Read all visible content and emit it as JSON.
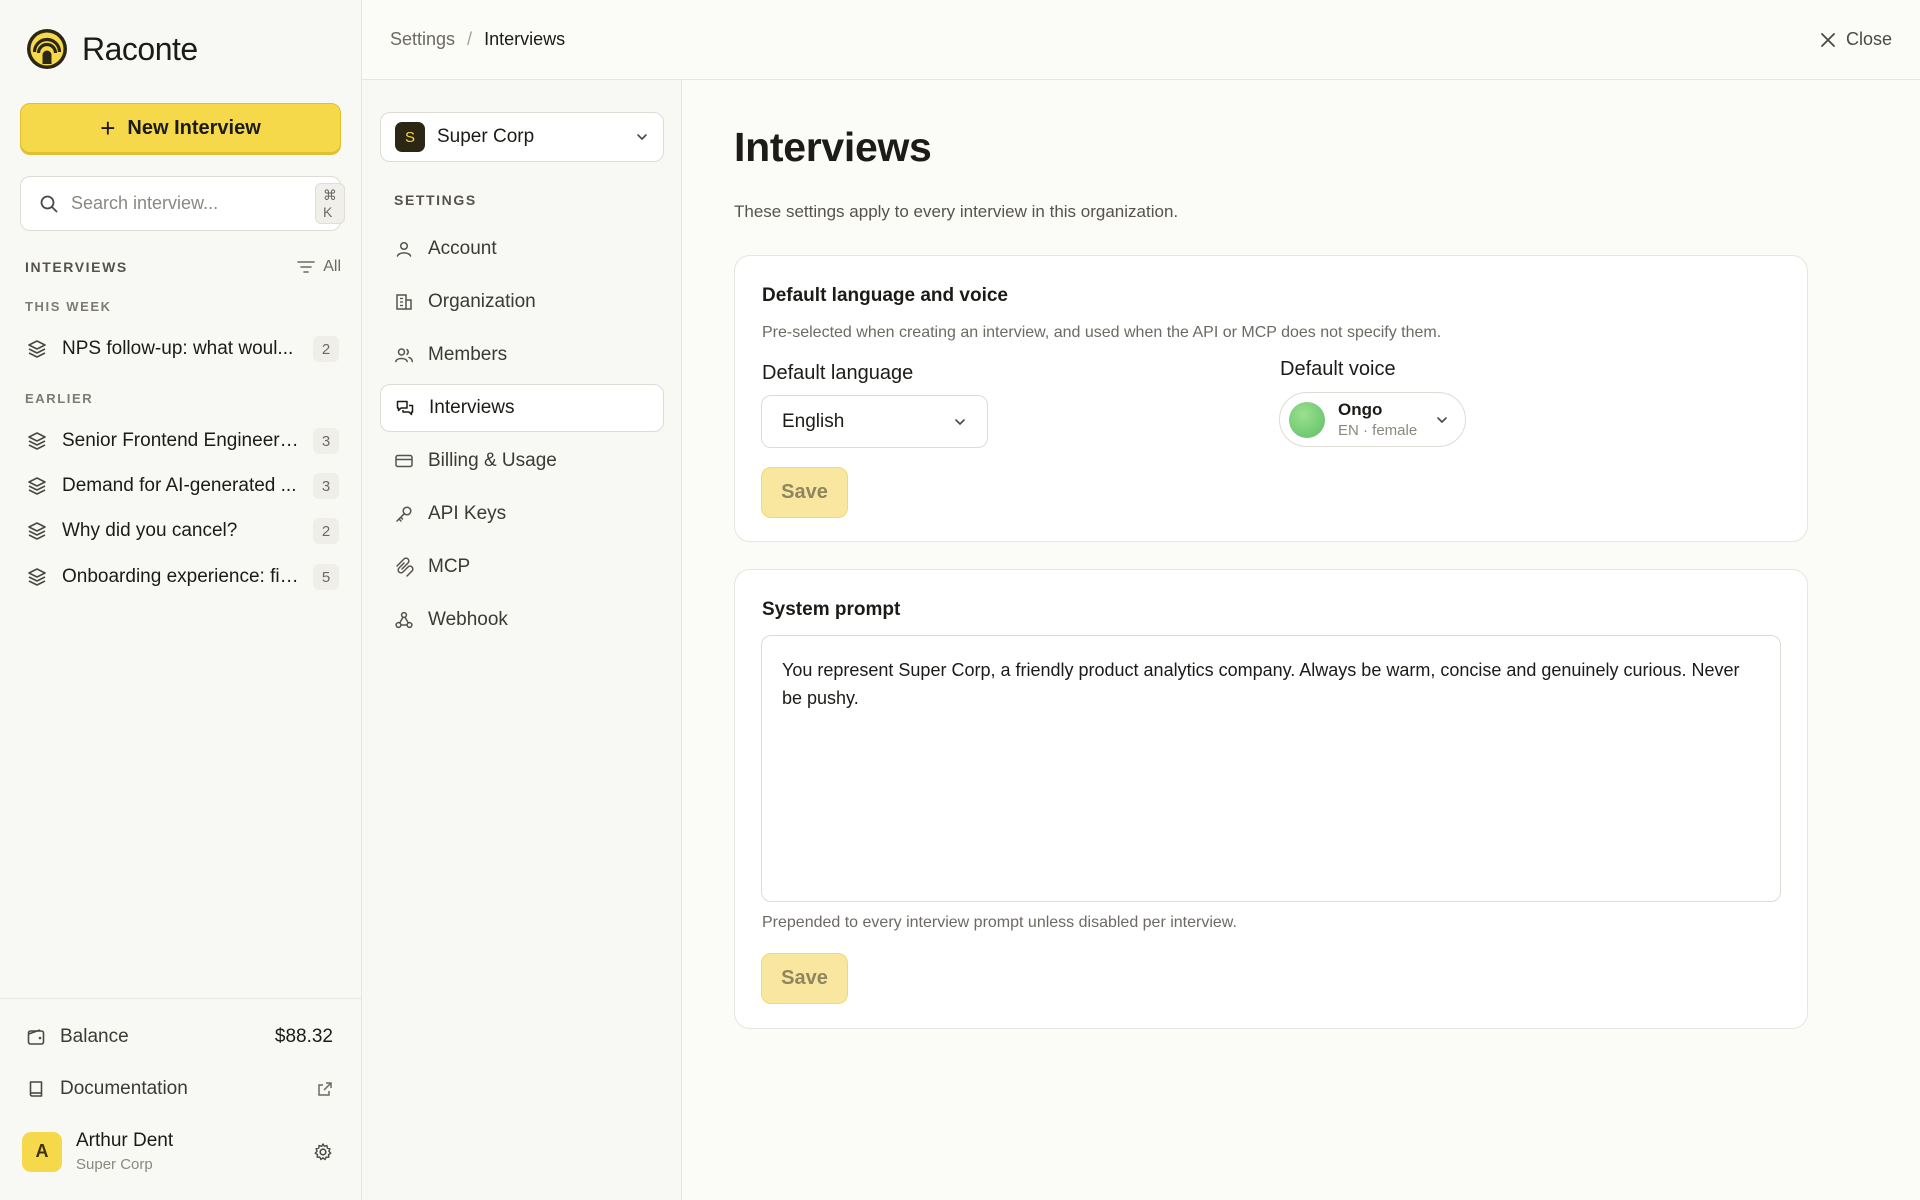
{
  "app": {
    "name": "Raconte"
  },
  "sidebar": {
    "new_button": "New Interview",
    "search": {
      "placeholder": "Search interview...",
      "shortcut": "⌘ K"
    },
    "section_title": "INTERVIEWS",
    "filter_label": "All",
    "groups": [
      {
        "label": "THIS WEEK",
        "items": [
          {
            "title": "NPS follow-up: what woul...",
            "count": "2"
          }
        ]
      },
      {
        "label": "EARLIER",
        "items": [
          {
            "title": "Senior Frontend Engineer ...",
            "count": "3"
          },
          {
            "title": "Demand for AI-generated ...",
            "count": "3"
          },
          {
            "title": "Why did you cancel?",
            "count": "2"
          },
          {
            "title": "Onboarding experience: fir...",
            "count": "5"
          }
        ]
      }
    ],
    "balance": {
      "label": "Balance",
      "value": "$88.32"
    },
    "documentation": "Documentation",
    "user": {
      "initial": "A",
      "name": "Arthur Dent",
      "org": "Super Corp"
    }
  },
  "topbar": {
    "breadcrumb": [
      "Settings",
      "Interviews"
    ],
    "close_label": "Close"
  },
  "settings_nav": {
    "org": {
      "initial": "S",
      "name": "Super Corp"
    },
    "title": "SETTINGS",
    "items": [
      {
        "label": "Account",
        "icon": "user-icon"
      },
      {
        "label": "Organization",
        "icon": "building-icon"
      },
      {
        "label": "Members",
        "icon": "users-icon"
      },
      {
        "label": "Interviews",
        "icon": "chat-icon",
        "active": true
      },
      {
        "label": "Billing & Usage",
        "icon": "card-icon"
      },
      {
        "label": "API Keys",
        "icon": "key-icon"
      },
      {
        "label": "MCP",
        "icon": "mcp-icon"
      },
      {
        "label": "Webhook",
        "icon": "webhook-icon"
      }
    ]
  },
  "page": {
    "title": "Interviews",
    "description": "These settings apply to every interview in this organization.",
    "language_card": {
      "title": "Default language and voice",
      "description": "Pre-selected when creating an interview, and used when the API or MCP does not specify them.",
      "language_label": "Default language",
      "language_value": "English",
      "voice_label": "Default voice",
      "voice_name": "Ongo",
      "voice_detail": "EN · female",
      "save_label": "Save"
    },
    "prompt_card": {
      "title": "System prompt",
      "prompt_text": "You represent Super Corp, a friendly product analytics company. Always be warm, concise and genuinely curious. Never be pushy.",
      "hint": "Prepended to every interview prompt unless disabled per interview.",
      "save_label": "Save"
    }
  },
  "colors": {
    "accent": "#f5d94a",
    "accent_disabled": "#f9e7a0",
    "background": "#fbfbf8"
  }
}
